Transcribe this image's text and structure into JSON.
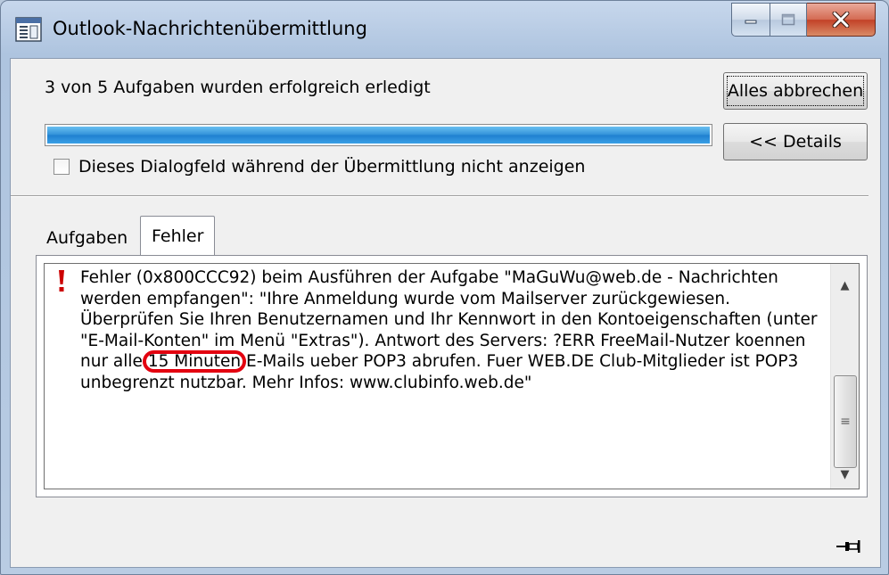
{
  "window": {
    "title": "Outlook-Nachrichtenübermittlung",
    "icon": "outlook-send-receive-icon"
  },
  "status": {
    "text": "3 von 5 Aufgaben wurden erfolgreich erledigt",
    "progress_fraction": 1.0
  },
  "buttons": {
    "cancel_all": "Alles abbrechen",
    "details": "<< Details"
  },
  "checkbox": {
    "label": "Dieses Dialogfeld während der Übermittlung nicht anzeigen",
    "checked": false
  },
  "tabs": [
    {
      "label": "Aufgaben",
      "selected": false
    },
    {
      "label": "Fehler",
      "selected": true
    }
  ],
  "error": {
    "icon": "error-exclamation-icon",
    "color": "#cc0000",
    "text_before": "Fehler (0x800CCC92) beim Ausführen der Aufgabe \"MaGuWu@web.de - Nachrichten werden empfangen\": \"Ihre Anmeldung wurde vom Mailserver zurückgewiesen. Überprüfen Sie Ihren Benutzernamen und Ihr Kennwort in den Kontoeigenschaften (unter \"E-Mail-Konten\" im Menü \"Extras\"). Antwort des Servers: ?ERR FreeMail-Nutzer koennen nur alle ",
    "highlight": "15 Minuten",
    "text_after": " E-Mails ueber POP3 abrufen. Fuer WEB.DE Club-Mitglieder ist POP3 unbegrenzt nutzbar. Mehr Infos: www.clubinfo.web.de\"",
    "highlight_color": "#e3000f"
  }
}
